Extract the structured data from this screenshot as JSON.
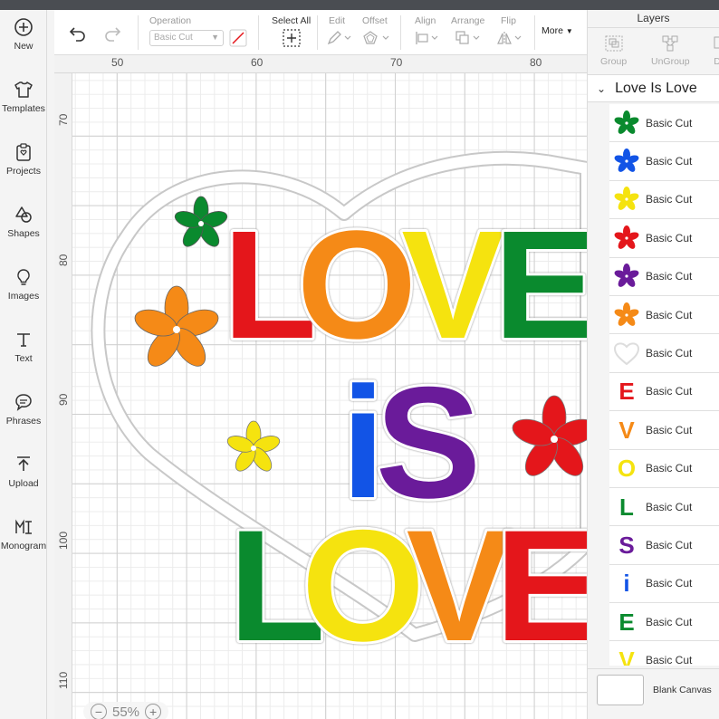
{
  "sidebar": {
    "items": [
      {
        "label": "New",
        "icon": "plus-circle-icon"
      },
      {
        "label": "Templates",
        "icon": "shirt-icon"
      },
      {
        "label": "Projects",
        "icon": "clipboard-icon"
      },
      {
        "label": "Shapes",
        "icon": "shapes-icon"
      },
      {
        "label": "Images",
        "icon": "lightbulb-icon"
      },
      {
        "label": "Text",
        "icon": "text-icon"
      },
      {
        "label": "Phrases",
        "icon": "speech-bubble-icon"
      },
      {
        "label": "Upload",
        "icon": "upload-icon"
      },
      {
        "label": "Monogram",
        "icon": "monogram-icon"
      }
    ]
  },
  "toolbar": {
    "operation_label": "Operation",
    "operation_value": "Basic Cut",
    "select_all_label": "Select All",
    "edit_label": "Edit",
    "offset_label": "Offset",
    "align_label": "Align",
    "arrange_label": "Arrange",
    "flip_label": "Flip",
    "more_label": "More"
  },
  "ruler": {
    "top": [
      "50",
      "60",
      "70",
      "80"
    ],
    "left": [
      "70",
      "80",
      "90",
      "100",
      "110"
    ]
  },
  "canvas": {
    "zoom": "55%",
    "words": {
      "top": [
        "L",
        "O",
        "V",
        "E"
      ],
      "middle": [
        "i",
        "S"
      ],
      "bottom": [
        "L",
        "O",
        "V",
        "E"
      ]
    }
  },
  "layers_panel": {
    "title": "Layers",
    "actions": {
      "group": "Group",
      "ungroup": "UnGroup",
      "partial": "D"
    },
    "group_name": "Love Is Love",
    "items": [
      {
        "label": "Basic Cut",
        "kind": "flower",
        "color": "#0a8a2e"
      },
      {
        "label": "Basic Cut",
        "kind": "flower",
        "color": "#1254e6"
      },
      {
        "label": "Basic Cut",
        "kind": "flower",
        "color": "#f5e30f"
      },
      {
        "label": "Basic Cut",
        "kind": "flower",
        "color": "#e4161b"
      },
      {
        "label": "Basic Cut",
        "kind": "flower",
        "color": "#6a1b9a"
      },
      {
        "label": "Basic Cut",
        "kind": "flower",
        "color": "#f58a17"
      },
      {
        "label": "Basic Cut",
        "kind": "outline",
        "color": "#dddddd"
      },
      {
        "label": "Basic Cut",
        "kind": "letter",
        "letter": "E",
        "color": "#e4161b"
      },
      {
        "label": "Basic Cut",
        "kind": "letter",
        "letter": "V",
        "color": "#f58a17"
      },
      {
        "label": "Basic Cut",
        "kind": "letter",
        "letter": "O",
        "color": "#f5e30f"
      },
      {
        "label": "Basic Cut",
        "kind": "letter",
        "letter": "L",
        "color": "#0a8a2e"
      },
      {
        "label": "Basic Cut",
        "kind": "letter",
        "letter": "S",
        "color": "#6a1b9a"
      },
      {
        "label": "Basic Cut",
        "kind": "letter",
        "letter": "i",
        "color": "#1254e6"
      },
      {
        "label": "Basic Cut",
        "kind": "letter",
        "letter": "E",
        "color": "#0a8a2e"
      },
      {
        "label": "Basic Cut",
        "kind": "letter",
        "letter": "V",
        "color": "#f5e30f"
      }
    ],
    "blank_canvas_label": "Blank Canvas"
  }
}
